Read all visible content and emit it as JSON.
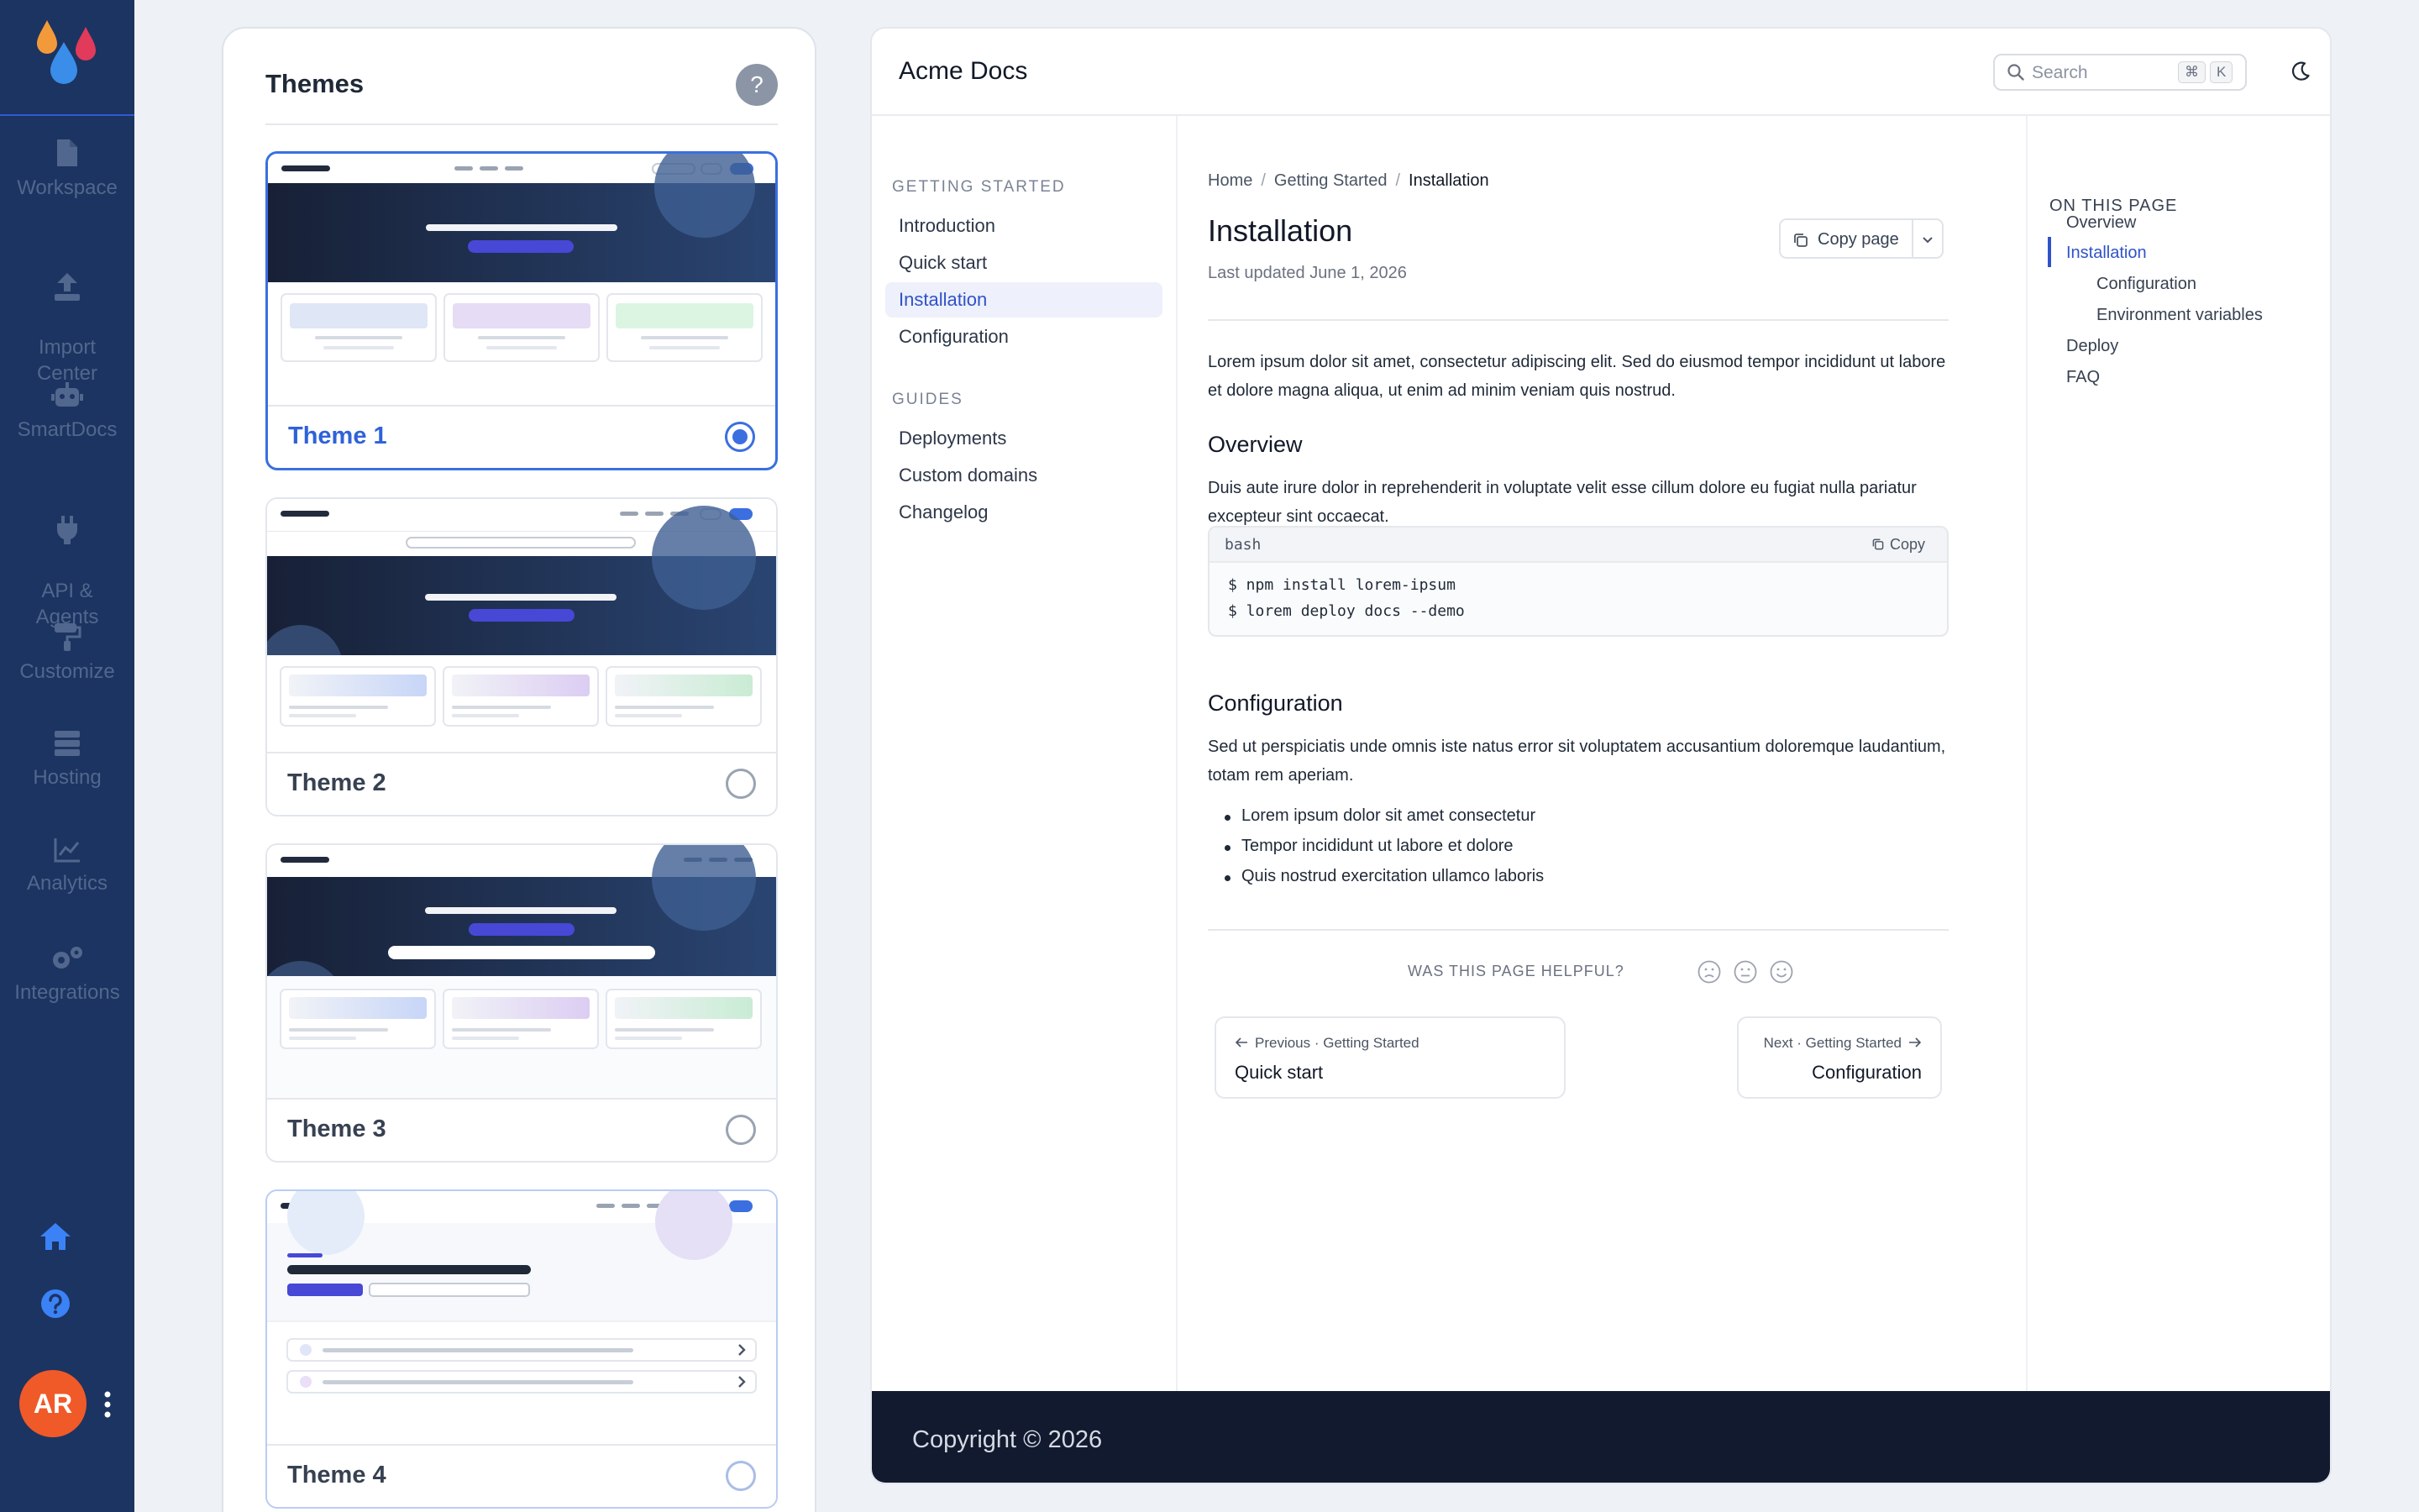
{
  "rail": {
    "items": [
      {
        "label": "Workspace",
        "icon": "document-icon"
      },
      {
        "label": "Import\nCenter",
        "icon": "upload-icon"
      },
      {
        "label": "SmartDocs",
        "icon": "robot-icon"
      },
      {
        "label": "API &\nAgents",
        "icon": "plug-icon"
      },
      {
        "label": "Customize",
        "icon": "paint-roller-icon"
      },
      {
        "label": "Hosting",
        "icon": "server-icon"
      },
      {
        "label": "Analytics",
        "icon": "chart-line-icon"
      },
      {
        "label": "Integrations",
        "icon": "gears-icon"
      }
    ],
    "avatar_initials": "AR",
    "accent": "#3b82f6"
  },
  "themes": {
    "title": "Themes",
    "help": "?",
    "cards": [
      {
        "name": "Theme 1",
        "selected": true
      },
      {
        "name": "Theme 2",
        "selected": false
      },
      {
        "name": "Theme 3",
        "selected": false
      },
      {
        "name": "Theme 4",
        "selected": false
      }
    ]
  },
  "docs": {
    "brand": "Acme Docs",
    "search": {
      "placeholder": "Search",
      "kbd1": "⌘",
      "kbd2": "K"
    },
    "nav": {
      "sections": [
        {
          "title": "GETTING STARTED",
          "items": [
            "Introduction",
            "Quick start",
            "Installation",
            "Configuration"
          ]
        },
        {
          "title": "GUIDES",
          "items": [
            "Deployments",
            "Custom domains",
            "Changelog"
          ]
        }
      ],
      "active": "Installation"
    },
    "breadcrumb": [
      "Home",
      "Getting Started",
      "Installation"
    ],
    "title": "Installation",
    "updated": "Last updated June 1, 2026",
    "copy_page": "Copy page",
    "intro": "Lorem ipsum dolor sit amet, consectetur adipiscing elit. Sed do eiusmod tempor incididunt ut labore et dolore magna aliqua, ut enim ad minim veniam quis nostrud.",
    "overview_h": "Overview",
    "overview_p": "Duis aute irure dolor in reprehenderit in voluptate velit esse cillum dolore eu fugiat nulla pariatur excepteur sint occaecat.",
    "code": {
      "lang": "bash",
      "copy": "Copy",
      "lines": [
        "$ npm install lorem-ipsum",
        "$ lorem deploy docs --demo"
      ]
    },
    "config_h": "Configuration",
    "config_p": "Sed ut perspiciatis unde omnis iste natus error sit voluptatem accusantium doloremque laudantium, totam rem aperiam.",
    "bullets": [
      "Lorem ipsum dolor sit amet consectetur",
      "Tempor incididunt ut labore et dolore",
      "Quis nostrud exercitation ullamco laboris"
    ],
    "helpful": "WAS THIS PAGE HELPFUL?",
    "prev": {
      "small": "Previous · Getting Started",
      "big": "Quick start"
    },
    "next": {
      "small": "Next · Getting Started",
      "big": "Configuration"
    },
    "toc": {
      "heading": "ON THIS PAGE",
      "items": [
        "Overview",
        "Installation",
        "Configuration",
        "Environment variables",
        "Deploy",
        "FAQ"
      ]
    },
    "footer": "Copyright © 2026"
  }
}
